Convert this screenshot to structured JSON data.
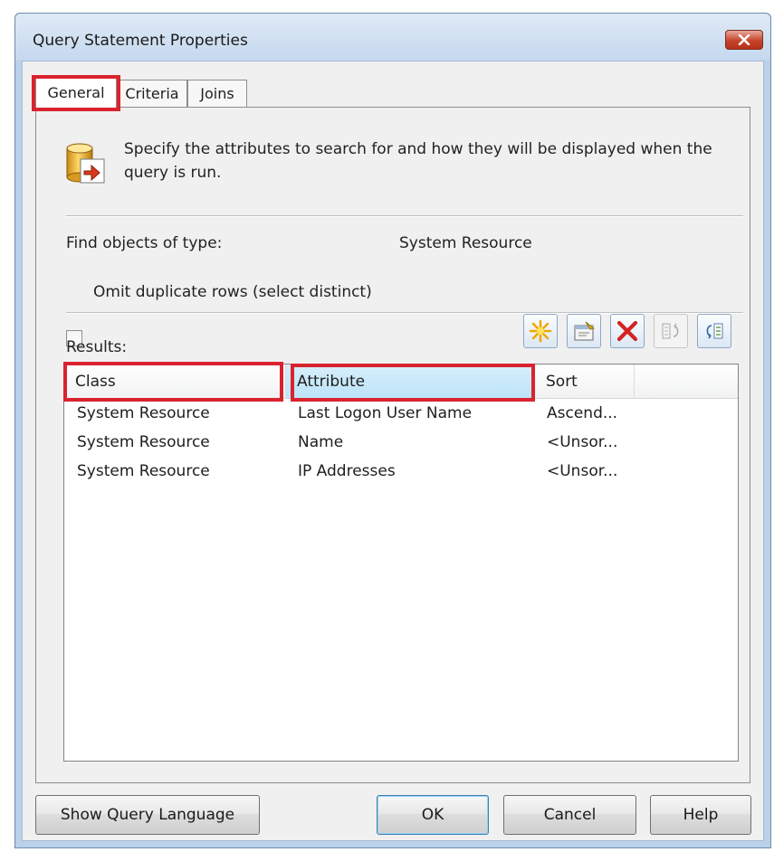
{
  "window": {
    "title": "Query Statement Properties"
  },
  "tabs": [
    {
      "label": "General",
      "active": true
    },
    {
      "label": "Criteria",
      "active": false
    },
    {
      "label": "Joins",
      "active": false
    }
  ],
  "general": {
    "description": "Specify the attributes to search for and how they will be displayed when the query is run.",
    "find_label": "Find objects of type:",
    "find_value": "System Resource",
    "omit_label": "Omit duplicate rows (select distinct)",
    "omit_checked": false,
    "results_label": "Results:"
  },
  "toolbar": [
    {
      "icon": "new-star-icon"
    },
    {
      "icon": "properties-icon"
    },
    {
      "icon": "delete-x-icon"
    },
    {
      "icon": "move-up-icon"
    },
    {
      "icon": "move-down-icon"
    }
  ],
  "results": {
    "columns": [
      "Class",
      "Attribute",
      "Sort"
    ],
    "rows": [
      [
        "System Resource",
        "Last Logon User Name",
        "Ascend..."
      ],
      [
        "System Resource",
        "Name",
        "<Unsor..."
      ],
      [
        "System Resource",
        "IP Addresses",
        "<Unsor..."
      ]
    ]
  },
  "buttons": {
    "show_query": "Show Query Language",
    "ok": "OK",
    "cancel": "Cancel",
    "help": "Help"
  },
  "colors": {
    "highlight": "#d9232f",
    "selected_header": "#bce4f8",
    "close_button": "#c5442b"
  }
}
